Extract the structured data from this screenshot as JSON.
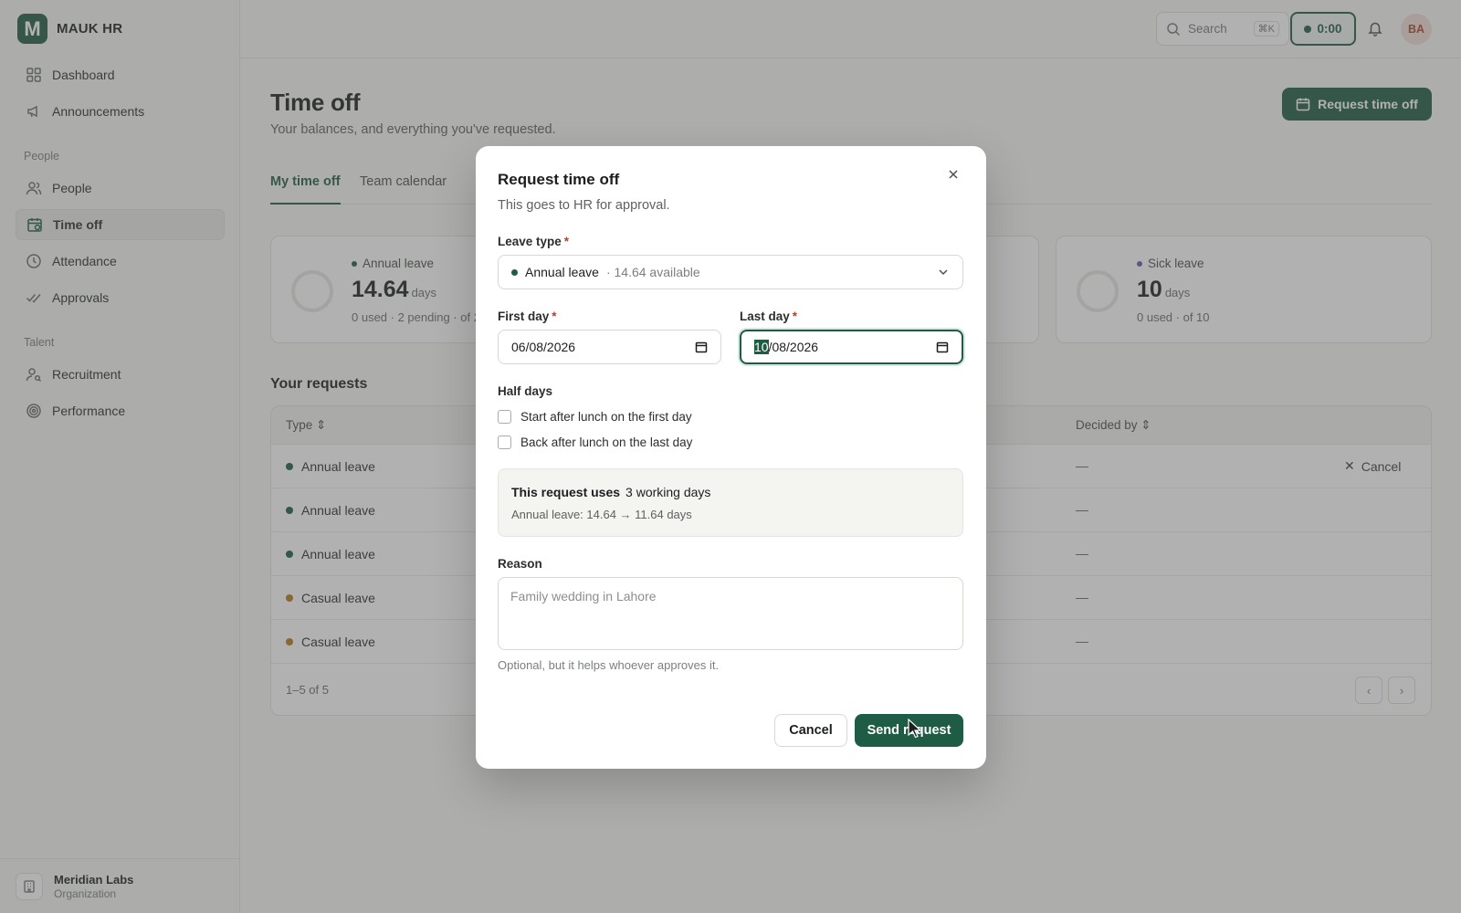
{
  "brand": {
    "logo_letter": "M",
    "name": "MAUK HR"
  },
  "sidebar": {
    "items": [
      {
        "label": "Dashboard",
        "icon": "grid-icon"
      },
      {
        "label": "Announcements",
        "icon": "megaphone-icon"
      }
    ],
    "people_section": "People",
    "people_items": [
      {
        "label": "People",
        "icon": "users-icon"
      },
      {
        "label": "Time off",
        "icon": "calendar-icon",
        "active": true
      },
      {
        "label": "Attendance",
        "icon": "clock-icon"
      },
      {
        "label": "Approvals",
        "icon": "check-double-icon"
      }
    ],
    "talent_section": "Talent",
    "talent_items": [
      {
        "label": "Recruitment",
        "icon": "user-search-icon"
      },
      {
        "label": "Performance",
        "icon": "target-icon"
      }
    ],
    "org": {
      "name": "Meridian Labs",
      "type": "Organization"
    }
  },
  "topbar": {
    "search_label": "Search",
    "search_shortcut": "⌘K",
    "timer": "0:00",
    "avatar_initials": "BA"
  },
  "page": {
    "title": "Time off",
    "subtitle": "Your balances, and everything you've requested.",
    "request_button": "Request time off",
    "tabs": [
      {
        "label": "My time off",
        "active": true
      },
      {
        "label": "Team calendar"
      }
    ]
  },
  "balances": [
    {
      "label": "Annual leave",
      "value": "14.64",
      "unit": "days",
      "meta": "0 used · 2 pending · of 2",
      "dot": "#1f5c45"
    },
    {
      "label": "Sick leave",
      "value": "10",
      "unit": "days",
      "meta": "0 used · of 10",
      "dot": "#6b5aa6"
    }
  ],
  "requests": {
    "title": "Your requests",
    "headers": {
      "type": "Type",
      "decided_by": "Decided by"
    },
    "rows": [
      {
        "type": "Annual leave",
        "decided": "—",
        "action": "Cancel",
        "dot": "#1f5c45"
      },
      {
        "type": "Annual leave",
        "decided": "—",
        "dot": "#1f5c45"
      },
      {
        "type": "Annual leave",
        "decided": "—",
        "dot": "#1f5c45"
      },
      {
        "type": "Casual leave",
        "decided": "—",
        "dot": "#b7791f"
      },
      {
        "type": "Casual leave",
        "decided": "—",
        "dot": "#b7791f"
      }
    ],
    "count": "1–5 of 5"
  },
  "modal": {
    "title": "Request time off",
    "subtitle": "This goes to HR for approval.",
    "leave_type_label": "Leave type",
    "leave_type_value": "Annual leave",
    "leave_type_available": "· 14.64 available",
    "first_day_label": "First day",
    "first_day_value": "06/08/2026",
    "last_day_label": "Last day",
    "last_day_selected": "10",
    "last_day_rest": "/08/2026",
    "half_days_label": "Half days",
    "half_day_first": "Start after lunch on the first day",
    "half_day_last": "Back after lunch on the last day",
    "summary_lead": "This request uses",
    "summary_days": "3 working days",
    "summary_detail": "Annual leave: 14.64 → 11.64 days",
    "reason_label": "Reason",
    "reason_placeholder": "Family wedding in Lahore",
    "reason_hint": "Optional, but it helps whoever approves it.",
    "cancel": "Cancel",
    "send": "Send request",
    "required_mark": "*"
  }
}
